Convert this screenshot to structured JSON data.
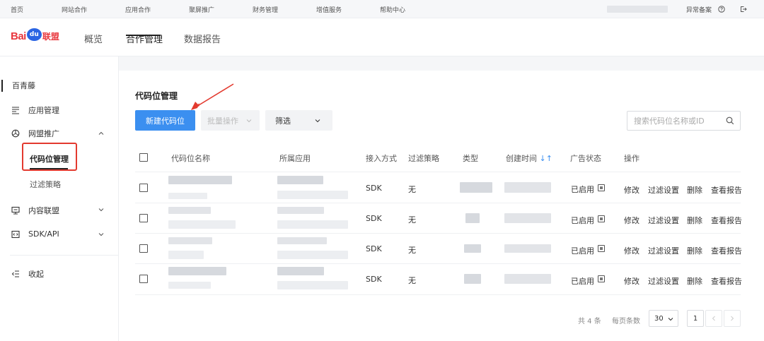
{
  "topbar": {
    "nav": [
      "首页",
      "网站合作",
      "应用合作",
      "聚屏推广",
      "财务管理",
      "增值服务",
      "帮助中心"
    ],
    "abnormal_filing": "异常备案"
  },
  "header": {
    "logo": {
      "bai": "Bai",
      "du": "du",
      "lm": "联盟"
    },
    "nav": [
      "概览",
      "合作管理",
      "数据报告"
    ],
    "active_nav": "合作管理"
  },
  "sidebar": {
    "brand": "百青藤",
    "items": [
      {
        "label": "应用管理",
        "icon": "list-icon"
      },
      {
        "label": "网盟推广",
        "icon": "target-icon",
        "expanded": true
      },
      {
        "label": "内容联盟",
        "icon": "content-icon"
      },
      {
        "label": "SDK/API",
        "icon": "code-icon"
      }
    ],
    "subitems": [
      "代码位管理",
      "过滤策略"
    ],
    "active_sub": "代码位管理",
    "collapse": "收起"
  },
  "main": {
    "title": "代码位管理",
    "new_button": "新建代码位",
    "batch_button": "批量操作",
    "filter_button": "筛选",
    "search_placeholder": "搜索代码位名称或ID",
    "table": {
      "headers": [
        "代码位名称",
        "所属应用",
        "接入方式",
        "过滤策略",
        "类型",
        "创建时间",
        "广告状态",
        "操作"
      ],
      "rows": [
        {
          "access": "SDK",
          "filter": "无",
          "status": "已启用"
        },
        {
          "access": "SDK",
          "filter": "无",
          "status": "已启用"
        },
        {
          "access": "SDK",
          "filter": "无",
          "status": "已启用"
        },
        {
          "access": "SDK",
          "filter": "无",
          "status": "已启用"
        }
      ],
      "operations": [
        "修改",
        "过滤设置",
        "删除",
        "查看报告"
      ]
    },
    "pagination": {
      "total": "共 4 条",
      "per_page_label": "每页条数",
      "per_page": "30",
      "current_page": "1"
    }
  },
  "colors": {
    "primary": "#3b8ff0",
    "highlight": "#e33a2f",
    "logo_red": "#e8373e",
    "logo_blue": "#2a64e3"
  }
}
